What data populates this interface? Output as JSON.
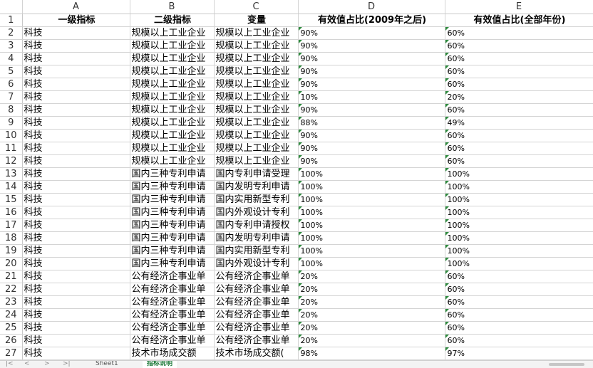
{
  "columns": [
    "A",
    "B",
    "C",
    "D",
    "E"
  ],
  "header_row": {
    "row_num": "1",
    "cells": [
      "一级指标",
      "二级指标",
      "变量",
      "有效值占比(2009年之后)",
      "有效值占比(全部年份)"
    ]
  },
  "rows": [
    {
      "n": "2",
      "a": "科技",
      "b": "规模以上工业企业",
      "c": "规模以上工业企业",
      "d": "90%",
      "e": "60%"
    },
    {
      "n": "3",
      "a": "科技",
      "b": "规模以上工业企业",
      "c": "规模以上工业企业",
      "d": "90%",
      "e": "60%"
    },
    {
      "n": "4",
      "a": "科技",
      "b": "规模以上工业企业",
      "c": "规模以上工业企业",
      "d": "90%",
      "e": "60%"
    },
    {
      "n": "5",
      "a": "科技",
      "b": "规模以上工业企业",
      "c": "规模以上工业企业",
      "d": "90%",
      "e": "60%"
    },
    {
      "n": "6",
      "a": "科技",
      "b": "规模以上工业企业",
      "c": "规模以上工业企业",
      "d": "90%",
      "e": "60%"
    },
    {
      "n": "7",
      "a": "科技",
      "b": "规模以上工业企业",
      "c": "规模以上工业企业",
      "d": "10%",
      "e": "20%"
    },
    {
      "n": "8",
      "a": "科技",
      "b": "规模以上工业企业",
      "c": "规模以上工业企业",
      "d": "90%",
      "e": "60%"
    },
    {
      "n": "9",
      "a": "科技",
      "b": "规模以上工业企业",
      "c": "规模以上工业企业",
      "d": "88%",
      "e": "49%"
    },
    {
      "n": "10",
      "a": "科技",
      "b": "规模以上工业企业",
      "c": "规模以上工业企业",
      "d": "90%",
      "e": "60%"
    },
    {
      "n": "11",
      "a": "科技",
      "b": "规模以上工业企业",
      "c": "规模以上工业企业",
      "d": "90%",
      "e": "60%"
    },
    {
      "n": "12",
      "a": "科技",
      "b": "规模以上工业企业",
      "c": "规模以上工业企业",
      "d": "90%",
      "e": "60%"
    },
    {
      "n": "13",
      "a": "科技",
      "b": "国内三种专利申请",
      "c": "国内专利申请受理",
      "d": "100%",
      "e": "100%"
    },
    {
      "n": "14",
      "a": "科技",
      "b": "国内三种专利申请",
      "c": "国内发明专利申请",
      "d": "100%",
      "e": "100%"
    },
    {
      "n": "15",
      "a": "科技",
      "b": "国内三种专利申请",
      "c": "国内实用新型专利",
      "d": "100%",
      "e": "100%"
    },
    {
      "n": "16",
      "a": "科技",
      "b": "国内三种专利申请",
      "c": "国内外观设计专利",
      "d": "100%",
      "e": "100%"
    },
    {
      "n": "17",
      "a": "科技",
      "b": "国内三种专利申请",
      "c": "国内专利申请授权",
      "d": "100%",
      "e": "100%"
    },
    {
      "n": "18",
      "a": "科技",
      "b": "国内三种专利申请",
      "c": "国内发明专利申请",
      "d": "100%",
      "e": "100%"
    },
    {
      "n": "19",
      "a": "科技",
      "b": "国内三种专利申请",
      "c": "国内实用新型专利",
      "d": "100%",
      "e": "100%"
    },
    {
      "n": "20",
      "a": "科技",
      "b": "国内三种专利申请",
      "c": "国内外观设计专利",
      "d": "100%",
      "e": "100%"
    },
    {
      "n": "21",
      "a": "科技",
      "b": "公有经济企事业单",
      "c": "公有经济企事业单",
      "d": "20%",
      "e": "60%"
    },
    {
      "n": "22",
      "a": "科技",
      "b": "公有经济企事业单",
      "c": "公有经济企事业单",
      "d": "20%",
      "e": "60%"
    },
    {
      "n": "23",
      "a": "科技",
      "b": "公有经济企事业单",
      "c": "公有经济企事业单",
      "d": "20%",
      "e": "60%"
    },
    {
      "n": "24",
      "a": "科技",
      "b": "公有经济企事业单",
      "c": "公有经济企事业单",
      "d": "20%",
      "e": "60%"
    },
    {
      "n": "25",
      "a": "科技",
      "b": "公有经济企事业单",
      "c": "公有经济企事业单",
      "d": "20%",
      "e": "60%"
    },
    {
      "n": "26",
      "a": "科技",
      "b": "公有经济企事业单",
      "c": "公有经济企事业单",
      "d": "20%",
      "e": "60%"
    },
    {
      "n": "27",
      "a": "科技",
      "b": "技术市场成交额",
      "c": "技术市场成交额(",
      "d": "98%",
      "e": "97%"
    }
  ],
  "sheet_tabs": [
    "Sheet1",
    "指标说明"
  ],
  "active_tab": "指标说明",
  "nav_glyphs": [
    "|<",
    "<",
    ">",
    ">|"
  ],
  "colors": {
    "accent": "#1e7a3a",
    "indicator": "#2e8b3e",
    "grid": "#d4d4d4"
  }
}
